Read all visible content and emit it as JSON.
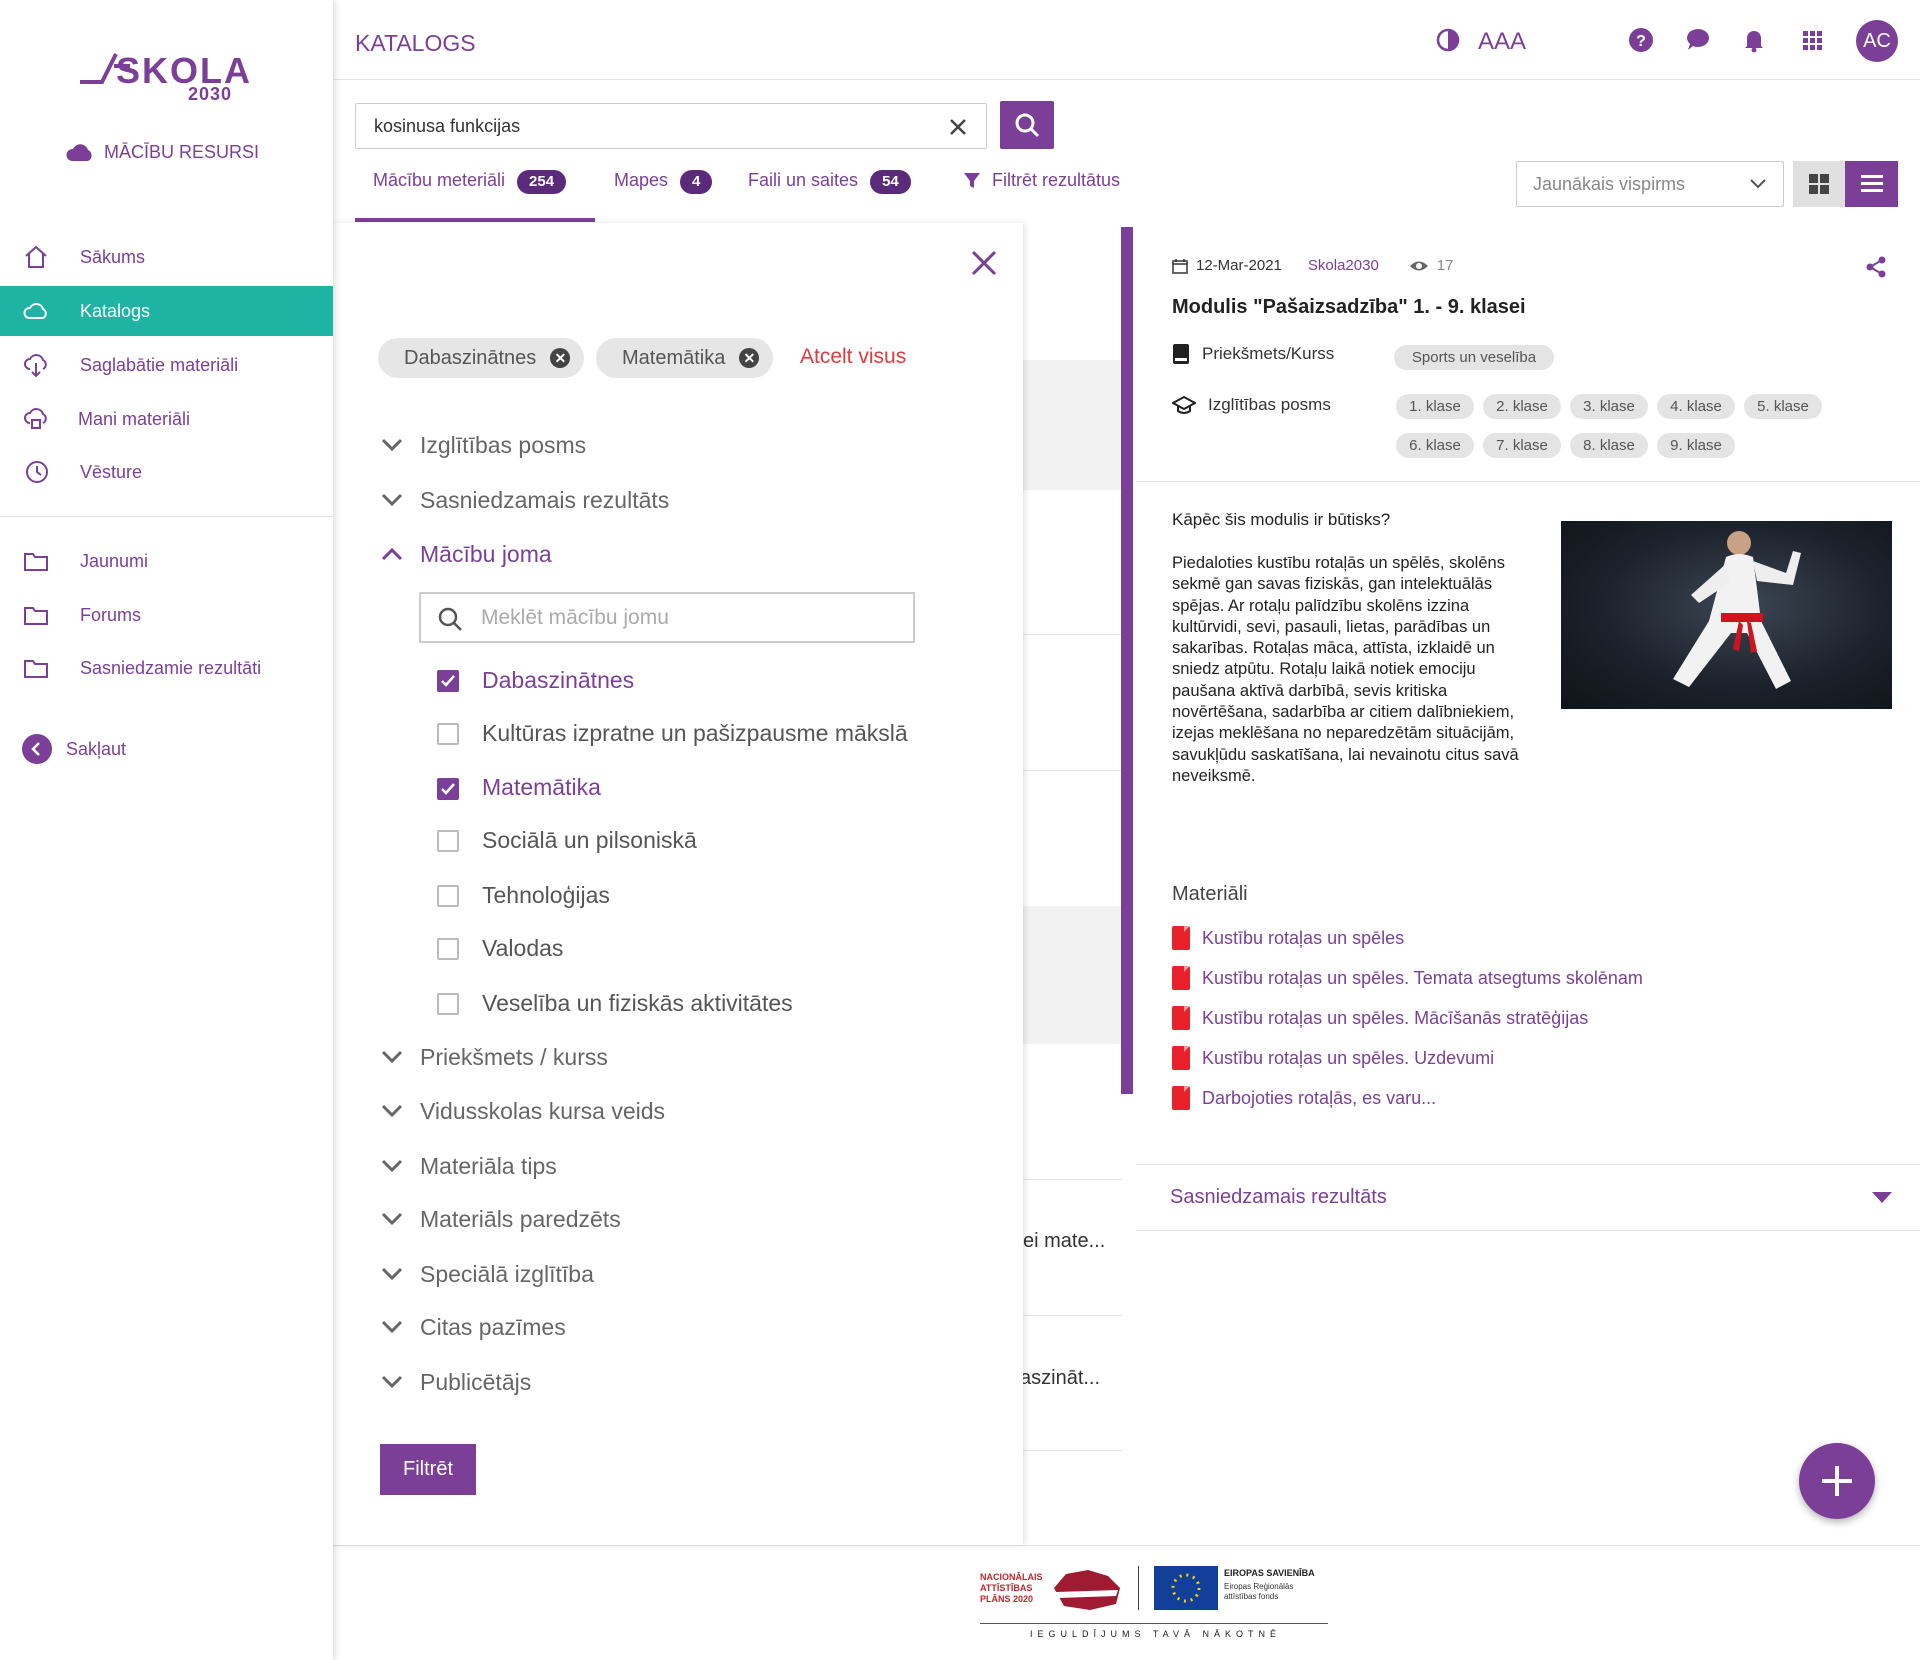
{
  "app": {
    "logo_name": "SKOLA",
    "logo_year": "2030",
    "section": "MĀCĪBU RESURSI"
  },
  "sidebar": {
    "items": [
      {
        "label": "Sākums",
        "icon": "home-icon"
      },
      {
        "label": "Katalogs",
        "icon": "cloud-icon",
        "active": true
      },
      {
        "label": "Saglabātie materiāli",
        "icon": "cloud-download-icon"
      },
      {
        "label": "Mani materiāli",
        "icon": "cloud-lock-icon"
      },
      {
        "label": "Vēsture",
        "icon": "history-icon"
      }
    ],
    "folders": [
      {
        "label": "Jaunumi"
      },
      {
        "label": "Forums"
      },
      {
        "label": "Sasniedzamie rezultāti"
      }
    ],
    "collapse_label": "Sakļaut"
  },
  "header": {
    "title": "KATALOGS",
    "font_size_label": "AAA",
    "avatar_initials": "AC"
  },
  "search": {
    "value": "kosinusa funkcijas"
  },
  "tabs": [
    {
      "label": "Mācību meteriāli",
      "count": "254",
      "active": true
    },
    {
      "label": "Mapes",
      "count": "4"
    },
    {
      "label": "Faili un saites",
      "count": "54"
    }
  ],
  "filter_results_label": "Filtrēt rezultātus",
  "sort": {
    "selected": "Jaunākais vispirms"
  },
  "filters": {
    "active_chips": [
      "Dabaszinātnes",
      "Matemātika"
    ],
    "clear_all": "Atcelt visus",
    "sections_top": [
      "Izglītības posms",
      "Sasniedzamais rezultāts"
    ],
    "open_section": "Mācību joma",
    "search_placeholder": "Meklēt mācību jomu",
    "options": [
      {
        "label": "Dabaszinātnes",
        "checked": true
      },
      {
        "label": "Kultūras izpratne un pašizpausme mākslā",
        "checked": false
      },
      {
        "label": "Matemātika",
        "checked": true
      },
      {
        "label": "Sociālā un pilsoniskā",
        "checked": false
      },
      {
        "label": "Tehnoloģijas",
        "checked": false
      },
      {
        "label": "Valodas",
        "checked": false
      },
      {
        "label": "Veselība un fiziskās aktivitātes",
        "checked": false
      }
    ],
    "sections_bottom": [
      "Priekšmets / kurss",
      "Vidusskolas kursa veids",
      "Materiāla tips",
      "Materiāls paredzēts",
      "Speciālā izglītība",
      "Citas pazīmes",
      "Publicētājs"
    ],
    "apply_label": "Filtrēt"
  },
  "background_list": {
    "snippets": [
      "ei mate...",
      "aszināt..."
    ]
  },
  "detail": {
    "date": "12-Mar-2021",
    "publisher": "Skola2030",
    "views": "17",
    "title": "Modulis \"Pašaizsadzība\" 1. - 9. klasei",
    "subject_label": "Priekšmets/Kurss",
    "subject_value": "Sports un veselība",
    "level_label": "Izglītības posms",
    "levels": [
      "1. klase",
      "2. klase",
      "3. klase",
      "4. klase",
      "5. klase",
      "6. klase",
      "7. klase",
      "8. klase",
      "9. klase"
    ],
    "why_heading": "Kāpēc šis modulis ir būtisks?",
    "description": "Piedaloties kustību rotaļās un spēlēs, skolēns sekmē gan savas fiziskās, gan intelektuālās spējas. Ar rotaļu palīdzību skolēns izzina kultūrvidi, sevi, pasauli, lietas, parādības un sakarības. Rotaļas māca, attīsta, izklaidē un sniedz atpūtu. Rotaļu laikā notiek emociju paušana aktīvā darbībā, sevis kritiska novērtēšana, sadarbība ar citiem dalībniekiem, izejas meklēšana no neparedzētām situācijām, savukļūdu saskatīšana, lai nevainotu citus savā neveiksmē.",
    "materials_heading": "Materiāli",
    "materials": [
      "Kustību rotaļas un spēles",
      "Kustību rotaļas un spēles. Temata atsegtums skolēnam",
      "Kustību rotaļas un spēles. Mācīšanās stratēģijas",
      "Kustību rotaļas un spēles. Uzdevumi",
      "Darbojoties rotaļās, es varu..."
    ],
    "accordion_label": "Sasniedzamais rezultāts"
  },
  "footer": {
    "nap_text": "NACIONĀLAIS ATTĪSTĪBAS PLĀNS 2020",
    "eu_title": "EIROPAS SAVIENĪBA",
    "eu_sub": "Eiropas Reģionālās attīstības fonds",
    "slogan": "IEGULDĪJUMS TAVĀ NĀKOTNĒ"
  },
  "colors": {
    "accent": "#7b3f98",
    "active_nav": "#1fb3a4",
    "clear_all": "#e0393e",
    "pdf": "#e8202a"
  }
}
